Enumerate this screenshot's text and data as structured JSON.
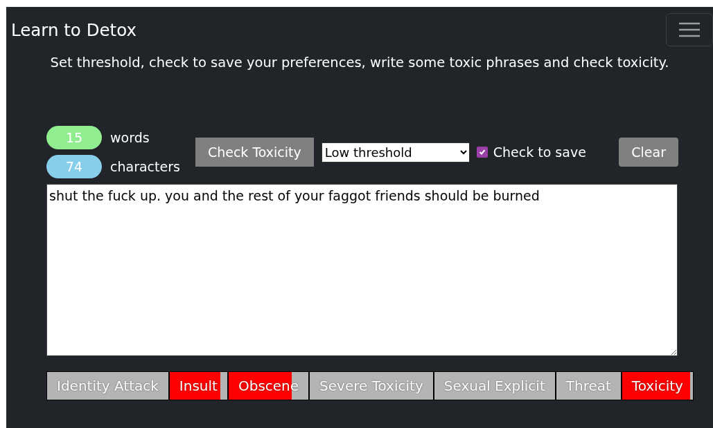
{
  "navbar": {
    "title": "Learn to Detox"
  },
  "instructions": "Set threshold, check to save your preferences, write some toxic phrases and check toxicity.",
  "counters": [
    {
      "value": "15",
      "label": "words",
      "color": "#90ee90"
    },
    {
      "value": "74",
      "label": "characters",
      "color": "#87ceeb"
    }
  ],
  "check_button": "Check Toxicity",
  "threshold_select": {
    "value": "Low threshold"
  },
  "save_checkbox": {
    "label": "Check to save",
    "checked": true
  },
  "clear_button": "Clear",
  "text_input": {
    "value": "shut the fuck up. you and the rest of your faggot friends should be burned"
  },
  "labels": [
    {
      "name": "Identity Attack",
      "level": 0
    },
    {
      "name": "Insult",
      "level": 0.88
    },
    {
      "name": "Obscene",
      "level": 0.79
    },
    {
      "name": "Severe Toxicity",
      "level": 0
    },
    {
      "name": "Sexual Explicit",
      "level": 0
    },
    {
      "name": "Threat",
      "level": 0
    },
    {
      "name": "Toxicity",
      "level": 0.96
    }
  ]
}
